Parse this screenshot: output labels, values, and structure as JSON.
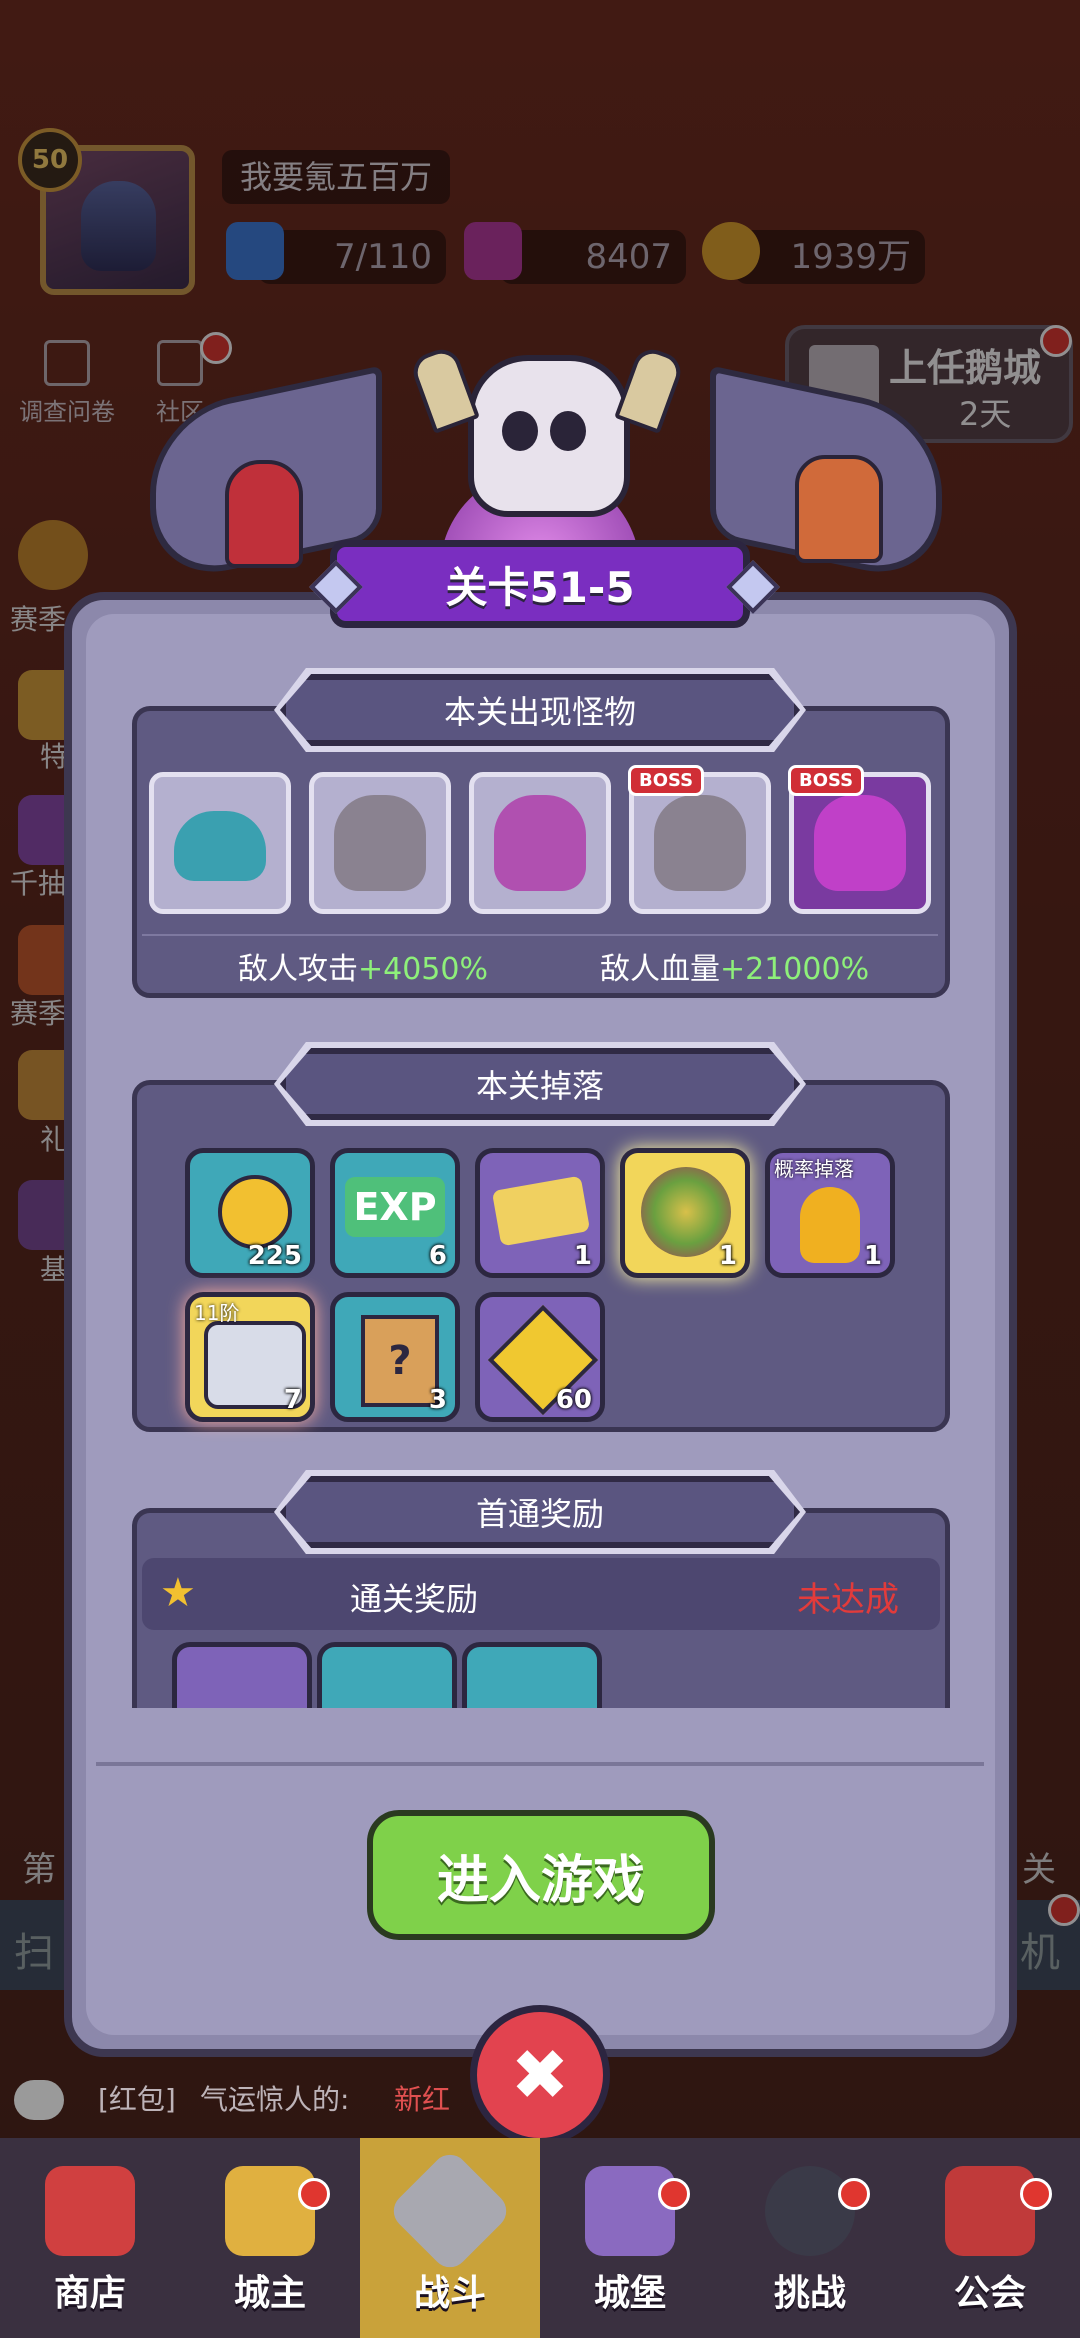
{
  "player": {
    "level": "50",
    "name": "我要氪五百万"
  },
  "resources": {
    "energy": "7/110",
    "gems": "8407",
    "gold": "1939万"
  },
  "top_links": [
    {
      "label": "调查问卷"
    },
    {
      "label": "社区"
    }
  ],
  "castle_event": {
    "title": "上任鹅城",
    "days": "2天"
  },
  "side_labels": [
    "赛季",
    "特",
    "千抽",
    "赛季",
    "礼",
    "基"
  ],
  "modal": {
    "title": "关卡51-5",
    "monsters_section": {
      "title": "本关出现怪物",
      "monsters": [
        {
          "name": "slime",
          "boss": false
        },
        {
          "name": "horned-knight",
          "boss": false
        },
        {
          "name": "purple-spider",
          "boss": false
        },
        {
          "name": "horned-knight",
          "boss": true,
          "badge": "BOSS"
        },
        {
          "name": "purple-spider",
          "boss": true,
          "badge": "BOSS"
        }
      ],
      "attack_label": "敌人攻击",
      "attack_value": "+4050%",
      "hp_label": "敌人血量",
      "hp_value": "+21000%"
    },
    "drops_section": {
      "title": "本关掉落",
      "items": [
        {
          "icon": "gold-coin",
          "count": "225"
        },
        {
          "icon": "exp",
          "label": "EXP",
          "count": "6"
        },
        {
          "icon": "ticket",
          "count": "1"
        },
        {
          "icon": "gem-pile",
          "count": "1"
        },
        {
          "icon": "fire-crystal",
          "tag": "概率掉落",
          "count": "1"
        },
        {
          "icon": "treasure-chest",
          "tag": "11阶",
          "count": "7"
        },
        {
          "icon": "scroll",
          "count": "3"
        },
        {
          "icon": "puzzle-piece",
          "count": "60"
        }
      ]
    },
    "first_clear_section": {
      "title": "首通奖励",
      "row_label": "通关奖励",
      "status": "未达成"
    },
    "enter_button": "进入游戏",
    "close_symbol": "✖"
  },
  "behind_text": {
    "left": "第",
    "right1": "关",
    "right2": "机",
    "left2": "扫"
  },
  "chat": {
    "prefix": "[红包]",
    "text": "气运惊人的:",
    "highlight": "新红"
  },
  "nav": [
    {
      "label": "商店",
      "active": false
    },
    {
      "label": "城主",
      "active": false
    },
    {
      "label": "战斗",
      "active": true
    },
    {
      "label": "城堡",
      "active": false
    },
    {
      "label": "挑战",
      "active": false
    },
    {
      "label": "公会",
      "active": false
    }
  ],
  "colors": {
    "accent_green": "#8ef07a",
    "status_red": "#e23b3b",
    "modal_bg": "#9f9bbd",
    "title_purple": "#7a2ec0"
  }
}
